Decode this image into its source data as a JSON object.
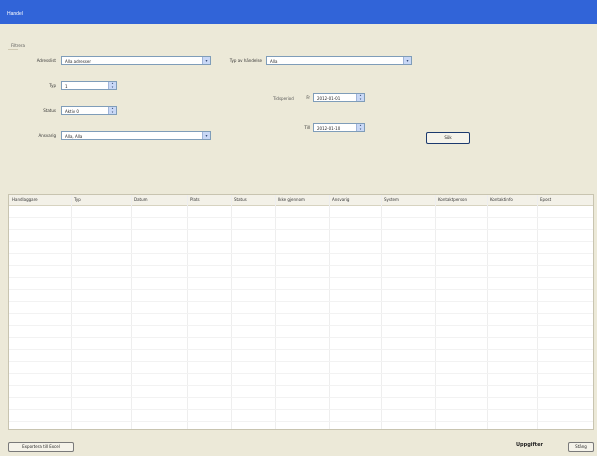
{
  "window": {
    "title": "Handel"
  },
  "filter": {
    "group_label": "Filtrera",
    "row1_label": "Adresslist",
    "row1_value": "Alla adresser",
    "row2_label": "Typ",
    "row2_value": "1",
    "row3_label": "Status",
    "row3_value": "Aktiv 0",
    "row4_label": "Ansvarig",
    "row4_value": "Alla, Alla",
    "right_label": "Typ av händelse",
    "right_value": "Alla",
    "period_label": "Tidsperiod",
    "from_label": "Fr",
    "from_value": "2012-01-01",
    "to_label": "Till",
    "to_value": "2012-01-10",
    "search_button": "Sök"
  },
  "grid": {
    "columns": [
      "Handlaggare",
      "Typ",
      "Datum",
      "Plats",
      "Status",
      "Ikke gjennom",
      "Ansvarig",
      "System",
      "Kontaktperson",
      "Kontaktinfo",
      "Epost"
    ]
  },
  "footer": {
    "status_text": "Uppgifter",
    "left_button": "Exportera till Excel",
    "right_button": "Stäng"
  }
}
